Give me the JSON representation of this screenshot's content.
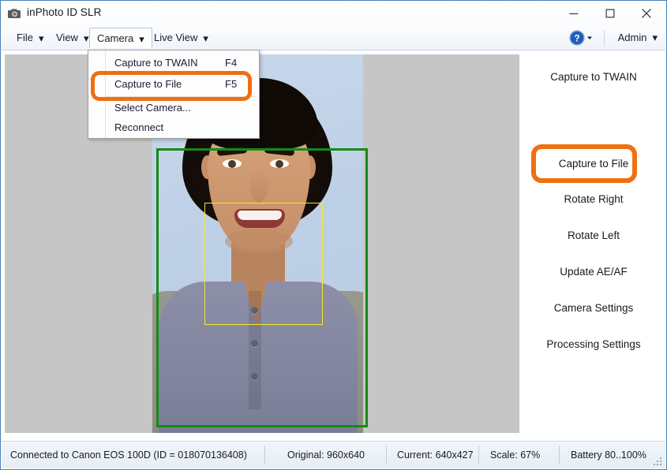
{
  "window": {
    "title": "inPhoto ID SLR",
    "icon": "camera-icon",
    "minimize_label": "Minimize",
    "maximize_label": "Maximize",
    "close_label": "Close"
  },
  "menubar": {
    "items": [
      {
        "label": "File",
        "caret": "▾"
      },
      {
        "label": "View",
        "caret": "▾"
      },
      {
        "label": "Camera",
        "caret": "▾"
      },
      {
        "label": "Live View",
        "caret": "▾"
      }
    ],
    "help": {
      "label": "?",
      "caret": "▾"
    },
    "user": {
      "label": "Admin",
      "caret": "▾"
    }
  },
  "camera_menu": {
    "items": [
      {
        "label": "Capture to TWAIN",
        "shortcut": "F4",
        "highlighted": false
      },
      {
        "label": "Capture to File",
        "shortcut": "F5",
        "highlighted": true
      },
      {
        "label": "Select Camera...",
        "shortcut": "",
        "highlighted": false
      },
      {
        "label": "Reconnect",
        "shortcut": "",
        "highlighted": false
      }
    ]
  },
  "sidebar": {
    "items": [
      {
        "label": "Capture to TWAIN",
        "highlighted": false
      },
      {
        "label": "Capture to File",
        "highlighted": true
      },
      {
        "label": "Rotate Right",
        "highlighted": false
      },
      {
        "label": "Rotate Left",
        "highlighted": false
      },
      {
        "label": "Update AE/AF",
        "highlighted": false
      },
      {
        "label": "Camera Settings",
        "highlighted": false
      },
      {
        "label": "Processing Settings",
        "highlighted": false
      }
    ]
  },
  "preview": {
    "crop_rect_color": "#158a15",
    "face_rect_color": "#f2e733",
    "canvas_background": "#c6c6c6",
    "subject_alt": "portrait-photo-of-man"
  },
  "statusbar": {
    "connection": "Connected to Canon EOS 100D (ID = 018070136408)",
    "original": "Original: 960x640",
    "current": "Current: 640x427",
    "scale": "Scale: 67%",
    "battery": "Battery 80..100%"
  },
  "colors": {
    "highlight_orange": "#ef6f11",
    "window_border": "#4a7fb5"
  }
}
